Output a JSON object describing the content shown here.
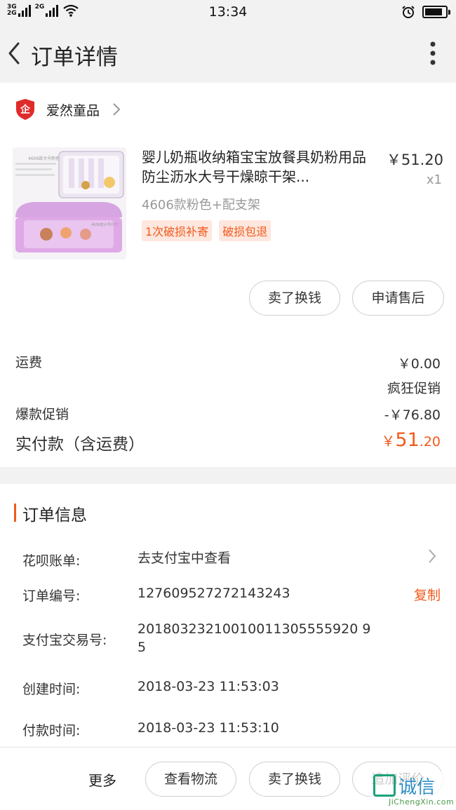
{
  "status_bar": {
    "sim1_label_top": "3G",
    "sim1_label_bottom": "2G",
    "sim2_label": "2G",
    "time": "13:34",
    "battery_level": 0.85
  },
  "nav": {
    "title": "订单详情"
  },
  "shop": {
    "name": "爱然童品"
  },
  "product": {
    "title": "婴儿奶瓶收纳箱宝宝放餐具奶粉用品防尘沥水大号干燥晾干架...",
    "price": "￥51.20",
    "quantity": "x1",
    "spec": "4606款粉色+配支架",
    "tags": [
      "1次破损补寄",
      "破损包退"
    ],
    "image_text_top": "4606款大号粉色",
    "image_text_bottom": "4606款大号尺寸"
  },
  "actions": {
    "sell_label": "卖了换钱",
    "after_sale_label": "申请售后"
  },
  "fees": {
    "shipping_label": "运费",
    "shipping_value": "￥0.00",
    "promo_name": "疯狂促销",
    "burst_promo_label": "爆款促销",
    "burst_promo_value": "-￥76.80",
    "paid_label": "实付款（含运费）",
    "paid_currency": "￥",
    "paid_int": "51",
    "paid_dec": ".20"
  },
  "order_info": {
    "section_title": "订单信息",
    "huabei_label": "花呗账单:",
    "huabei_value": "去支付宝中查看",
    "order_no_label": "订单编号:",
    "order_no_value": "127609527272143243",
    "copy_label": "复制",
    "alipay_no_label": "支付宝交易号:",
    "alipay_no_line1": "20180323210010011305555920 9",
    "alipay_no_line2": "5",
    "created_label": "创建时间:",
    "created_value": "2018-03-23 11:53:03",
    "paid_time_label": "付款时间:",
    "paid_time_value": "2018-03-23 11:53:10"
  },
  "bottom_bar": {
    "more_label": "更多",
    "logistics_label": "查看物流",
    "sell_label": "卖了换钱",
    "review_label": "追加评价"
  },
  "watermark": {
    "text": "诚信",
    "url": "JiChengXin.com"
  },
  "colors": {
    "accent": "#f25a1c",
    "tag_bg": "#fde7de",
    "page_bg": "#f2f2f2"
  },
  "icons": [
    "back-arrow-icon",
    "more-vertical-icon",
    "shop-logo-icon",
    "chevron-right-icon",
    "wifi-icon",
    "alarm-icon",
    "battery-icon"
  ]
}
